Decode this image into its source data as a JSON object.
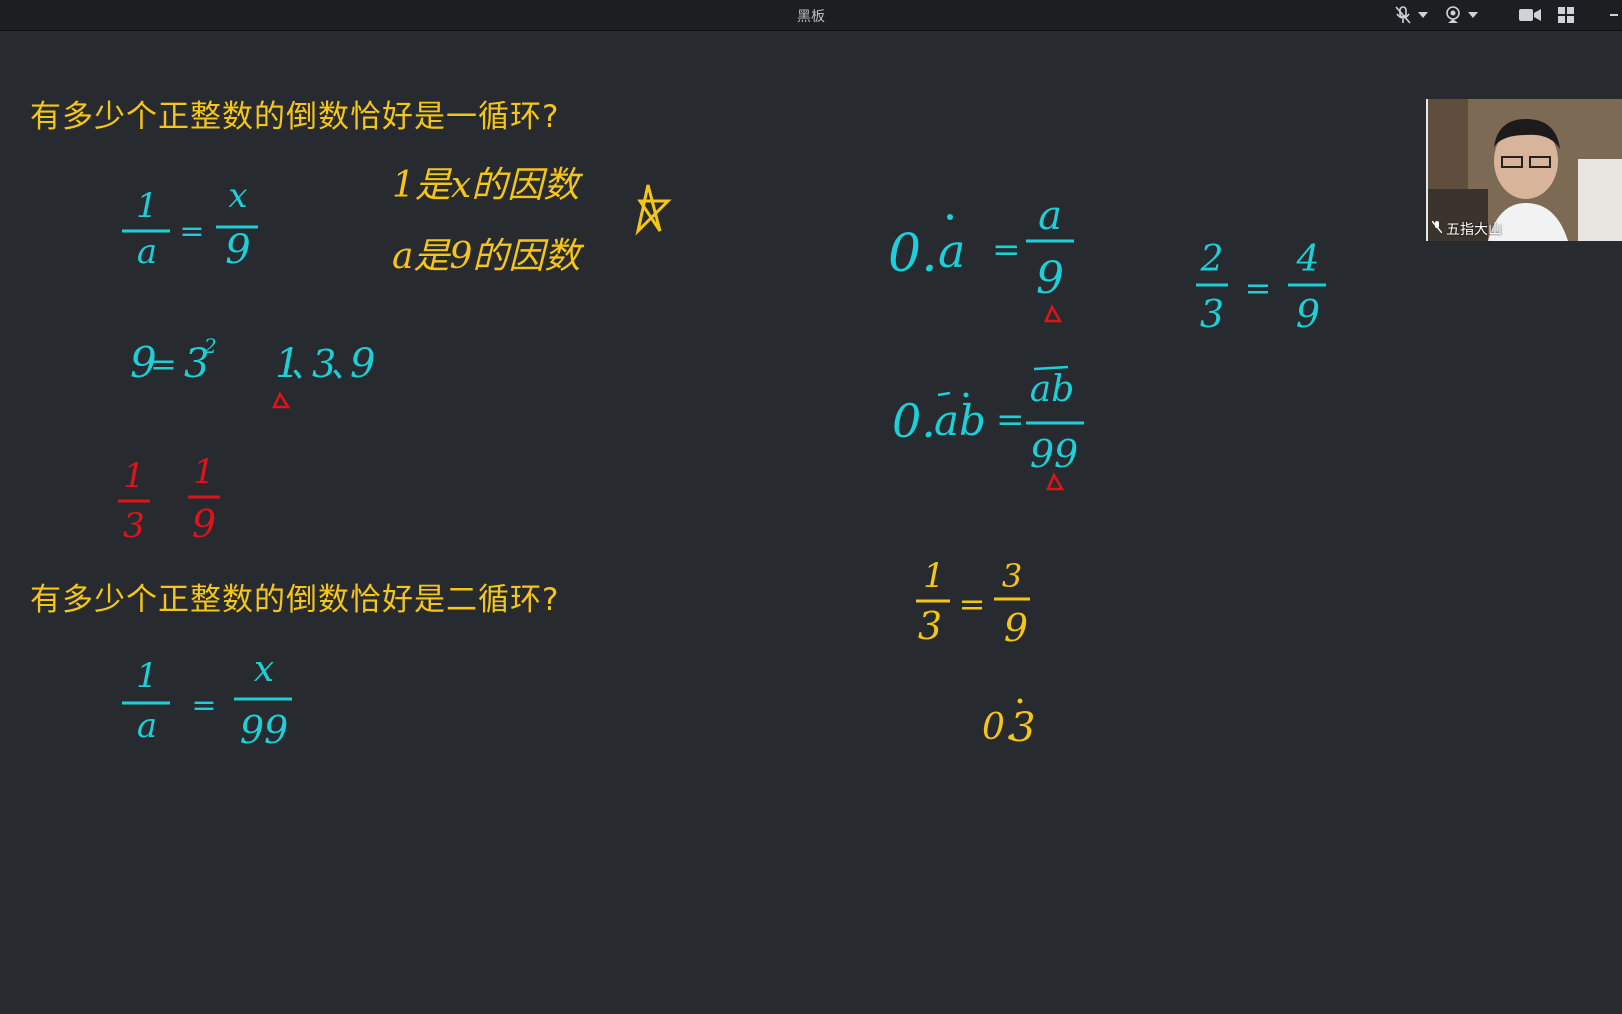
{
  "window": {
    "title": "黑板"
  },
  "toolbar": {
    "mic_icon": "mic-muted-icon",
    "camera_icon": "webcam-icon",
    "video_icon": "video-camera-icon",
    "layout_icon": "grid-layout-icon",
    "dropdown_icon": "chevron-down-icon"
  },
  "board": {
    "question1": "有多少个正整数的倒数恰好是一循环?",
    "question2": "有多少个正整数的倒数恰好是二循环?",
    "note1": "1是x的因数",
    "note2": "a是9的因数"
  },
  "video": {
    "participant_name": "五指大山"
  },
  "colors": {
    "background": "#272b30",
    "yellow_ink": "#f5c518",
    "cyan_ink": "#1ccfd8",
    "red_ink": "#e0131b"
  }
}
